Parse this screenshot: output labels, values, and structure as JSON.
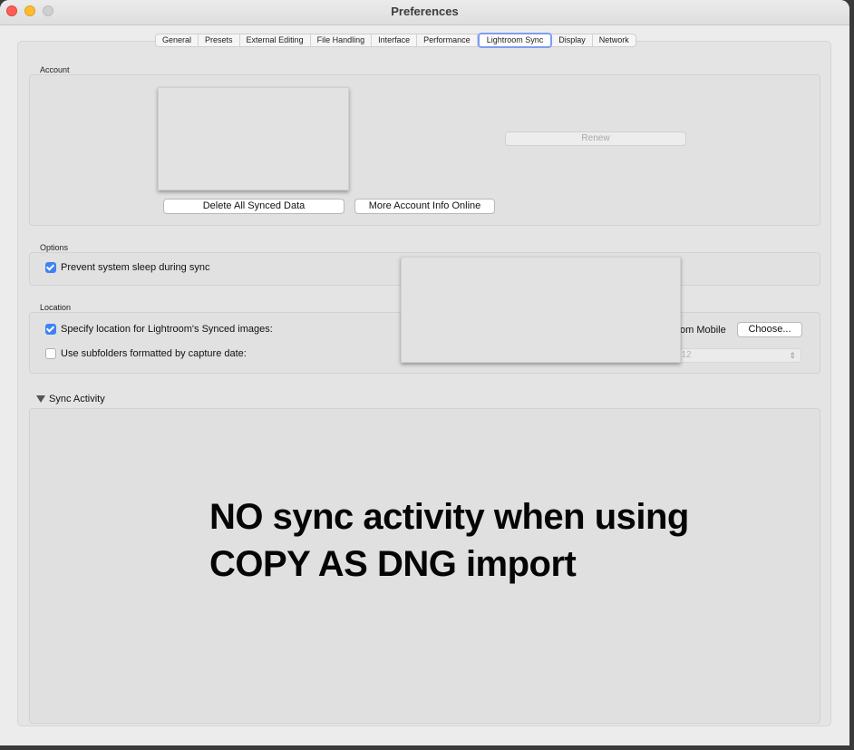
{
  "window": {
    "title": "Preferences"
  },
  "tabs": [
    {
      "label": "General",
      "active": false
    },
    {
      "label": "Presets",
      "active": false
    },
    {
      "label": "External Editing",
      "active": false
    },
    {
      "label": "File Handling",
      "active": false
    },
    {
      "label": "Interface",
      "active": false
    },
    {
      "label": "Performance",
      "active": false
    },
    {
      "label": "Lightroom Sync",
      "active": true
    },
    {
      "label": "Display",
      "active": false
    },
    {
      "label": "Network",
      "active": false
    }
  ],
  "account": {
    "section_label": "Account",
    "renew_label": "Renew",
    "delete_label": "Delete All Synced Data",
    "more_info_label": "More Account Info Online"
  },
  "options": {
    "section_label": "Options",
    "prevent_sleep_label": "Prevent system sleep during sync",
    "prevent_sleep_checked": true
  },
  "location": {
    "section_label": "Location",
    "specify_label": "Specify location for Lightroom's Synced images:",
    "specify_checked": true,
    "partial_text": "om Mobile",
    "choose_label": "Choose...",
    "subfolders_label": "Use subfolders formatted by capture date:",
    "subfolders_checked": false,
    "date_format_value": "02-12"
  },
  "sync_activity": {
    "label": "Sync Activity",
    "annotation_line1": "NO sync activity when using",
    "annotation_line2": "COPY AS DNG import"
  },
  "colors": {
    "accent": "#3c82f6",
    "tab_focus": "#7d9ff0",
    "close": "#ff5f57",
    "minimize": "#febc2e"
  }
}
